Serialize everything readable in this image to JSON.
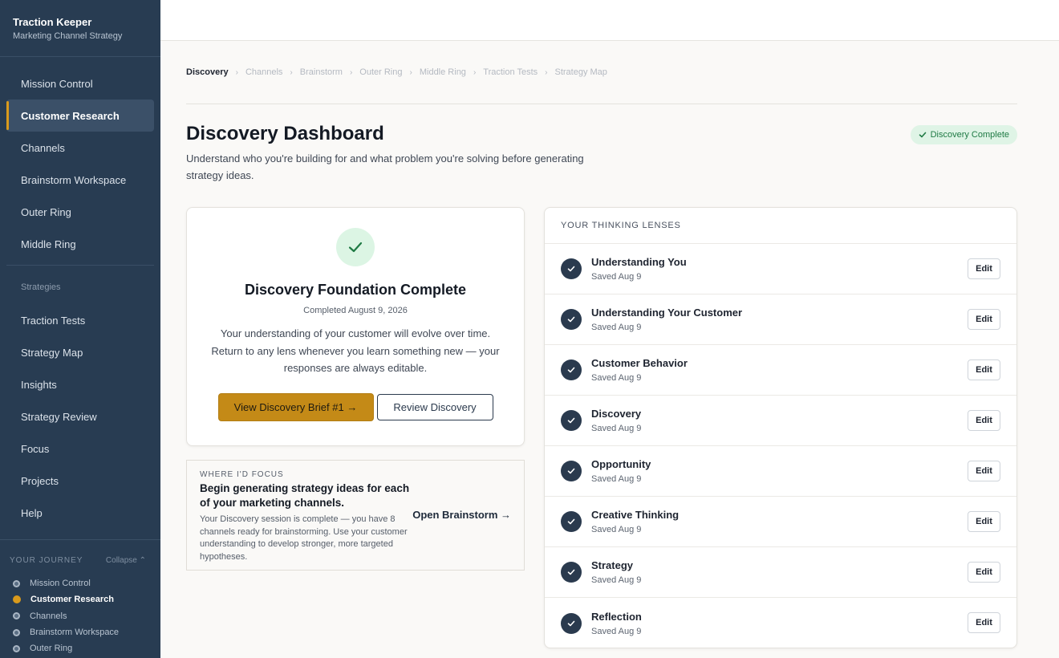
{
  "app": {
    "title": "Traction Keeper",
    "subtitle": "Marketing Channel Strategy"
  },
  "sidebar": {
    "items_top": [
      {
        "label": "Mission Control",
        "active": false
      },
      {
        "label": "Customer Research",
        "active": true
      },
      {
        "label": "Channels",
        "active": false
      },
      {
        "label": "Brainstorm Workspace",
        "active": false
      },
      {
        "label": "Outer Ring",
        "active": false
      },
      {
        "label": "Middle Ring",
        "active": false
      }
    ],
    "section_label": "Strategies",
    "items_bottom": [
      {
        "label": "Traction Tests"
      },
      {
        "label": "Strategy Map"
      },
      {
        "label": "Insights"
      },
      {
        "label": "Strategy Review"
      },
      {
        "label": "Focus"
      },
      {
        "label": "Projects"
      },
      {
        "label": "Help"
      }
    ],
    "journey": {
      "title": "YOUR JOURNEY",
      "collapse_label": "Collapse ⌃",
      "items": [
        {
          "label": "Mission Control",
          "state": "done"
        },
        {
          "label": "Customer Research",
          "state": "current"
        },
        {
          "label": "Channels",
          "state": "done"
        },
        {
          "label": "Brainstorm Workspace",
          "state": "done"
        },
        {
          "label": "Outer Ring",
          "state": "done"
        }
      ]
    }
  },
  "breadcrumb": {
    "items": [
      "Discovery",
      "Channels",
      "Brainstorm",
      "Outer Ring",
      "Middle Ring",
      "Traction Tests",
      "Strategy Map"
    ],
    "separator": "›"
  },
  "header": {
    "title": "Discovery Dashboard",
    "subtitle": "Understand who you're building for and what problem you're solving before generating strategy ideas.",
    "badge": "Discovery Complete"
  },
  "complete_card": {
    "title": "Discovery Foundation Complete",
    "date": "Completed August 9, 2026",
    "body": "Your understanding of your customer will evolve over time. Return to any lens whenever you learn something new — your responses are always editable.",
    "primary_label": "View Discovery Brief #1 →",
    "secondary_label": "Review Discovery"
  },
  "focus": {
    "label": "WHERE I'D FOCUS",
    "title": "Begin generating strategy ideas for each of your marketing channels.",
    "body": "Your Discovery session is complete — you have 8 channels ready for brainstorming. Use your customer understanding to develop stronger, more targeted hypotheses.",
    "link_label": "Open Brainstorm →"
  },
  "lenses": {
    "heading": "YOUR THINKING LENSES",
    "edit_label": "Edit",
    "items": [
      {
        "name": "Understanding You",
        "saved": "Saved Aug 9"
      },
      {
        "name": "Understanding Your Customer",
        "saved": "Saved Aug 9"
      },
      {
        "name": "Customer Behavior",
        "saved": "Saved Aug 9"
      },
      {
        "name": "Discovery",
        "saved": "Saved Aug 9"
      },
      {
        "name": "Opportunity",
        "saved": "Saved Aug 9"
      },
      {
        "name": "Creative Thinking",
        "saved": "Saved Aug 9"
      },
      {
        "name": "Strategy",
        "saved": "Saved Aug 9"
      },
      {
        "name": "Reflection",
        "saved": "Saved Aug 9"
      }
    ]
  },
  "colors": {
    "sidebar_bg": "#283c52",
    "accent": "#d99a1c",
    "primary_button": "#c48a17",
    "success": "#1f7a44",
    "lens_check": "#2a3a4e"
  }
}
